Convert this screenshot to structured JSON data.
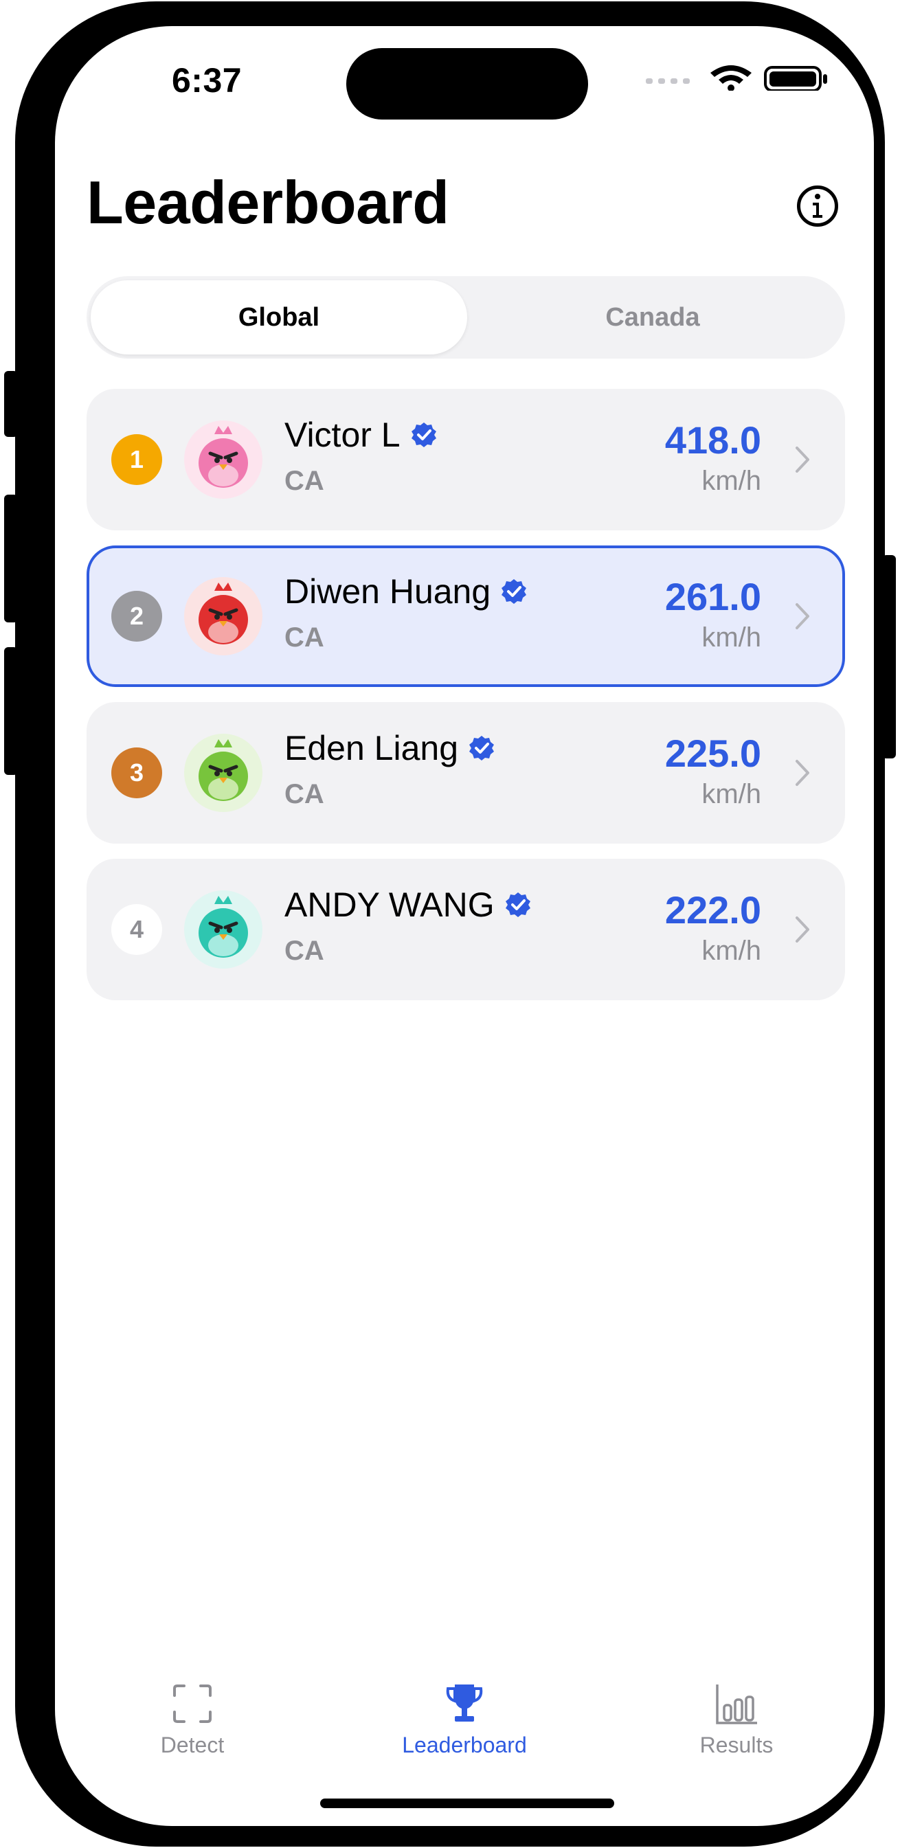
{
  "status_bar": {
    "time": "6:37"
  },
  "header": {
    "title": "Leaderboard"
  },
  "segments": {
    "global": "Global",
    "canada": "Canada",
    "selected": "Global"
  },
  "leaderboard": [
    {
      "rank": "1",
      "name": "Victor L",
      "country": "CA",
      "speed": "418.0",
      "unit": "km/h",
      "rank_color": "#f5a800",
      "bird_color": "#f07ab0",
      "bird_bg": "#fde4ee"
    },
    {
      "rank": "2",
      "name": "Diwen Huang",
      "country": "CA",
      "speed": "261.0",
      "unit": "km/h",
      "rank_color": "#9a9a9e",
      "bird_color": "#e03030",
      "bird_bg": "#fbe3e3"
    },
    {
      "rank": "3",
      "name": "Eden Liang",
      "country": "CA",
      "speed": "225.0",
      "unit": "km/h",
      "rank_color": "#d07a2a",
      "bird_color": "#78c43c",
      "bird_bg": "#e8f5dc"
    },
    {
      "rank": "4",
      "name": "ANDY WANG",
      "country": "CA",
      "speed": "222.0",
      "unit": "km/h",
      "rank_color": "#ffffff",
      "bird_color": "#2ec6b0",
      "bird_bg": "#dff6f2"
    }
  ],
  "tab_bar": {
    "detect": "Detect",
    "leaderboard": "Leaderboard",
    "results": "Results",
    "active": "Leaderboard"
  },
  "colors": {
    "accent": "#2f5be0",
    "muted": "#8e8e93",
    "card_bg": "#f2f2f4",
    "highlight_bg": "#e7ebfc"
  }
}
